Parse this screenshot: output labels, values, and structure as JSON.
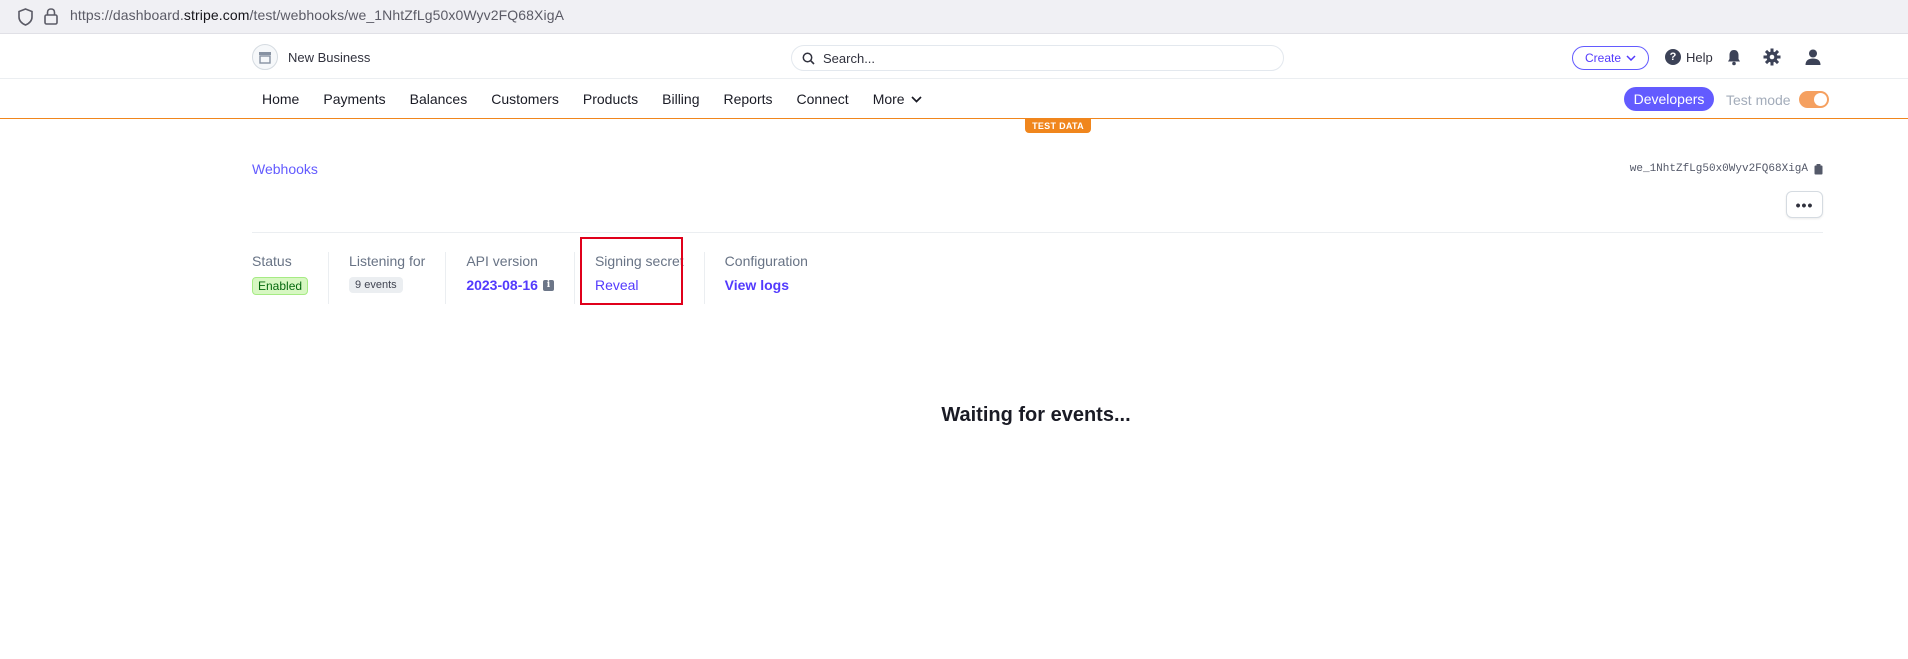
{
  "browser": {
    "url_prefix": "https://dashboard.",
    "url_host": "stripe.com",
    "url_path": "/test/webhooks/we_1NhtZfLg50x0Wyv2FQ68XigA",
    "shield_icon": "shield-icon",
    "lock_icon": "lock-icon"
  },
  "header": {
    "account_name": "New Business",
    "account_icon": "store-icon",
    "search_placeholder": "Search...",
    "create_label": "Create",
    "help_label": "Help",
    "icons": [
      "bell-icon",
      "gear-icon",
      "user-icon"
    ]
  },
  "nav": {
    "items": [
      "Home",
      "Payments",
      "Balances",
      "Customers",
      "Products",
      "Billing",
      "Reports",
      "Connect"
    ],
    "more_label": "More",
    "developers_label": "Developers",
    "test_mode_label": "Test mode",
    "test_mode_on": true
  },
  "test_data_label": "TEST DATA",
  "page": {
    "breadcrumb": "Webhooks",
    "webhook_id": "we_1NhtZfLg50x0Wyv2FQ68XigA",
    "more_label": "•••",
    "facts": {
      "status_label": "Status",
      "status_value": "Enabled",
      "listening_label": "Listening for",
      "listening_value": "9 events",
      "api_label": "API version",
      "api_value": "2023-08-16",
      "secret_label": "Signing secret",
      "secret_value": "Reveal",
      "config_label": "Configuration",
      "config_value": "View logs"
    },
    "waiting_text": "Waiting for events..."
  },
  "colors": {
    "accent": "#635bff",
    "test_orange": "#f0861d",
    "highlight": "#e0001b"
  }
}
